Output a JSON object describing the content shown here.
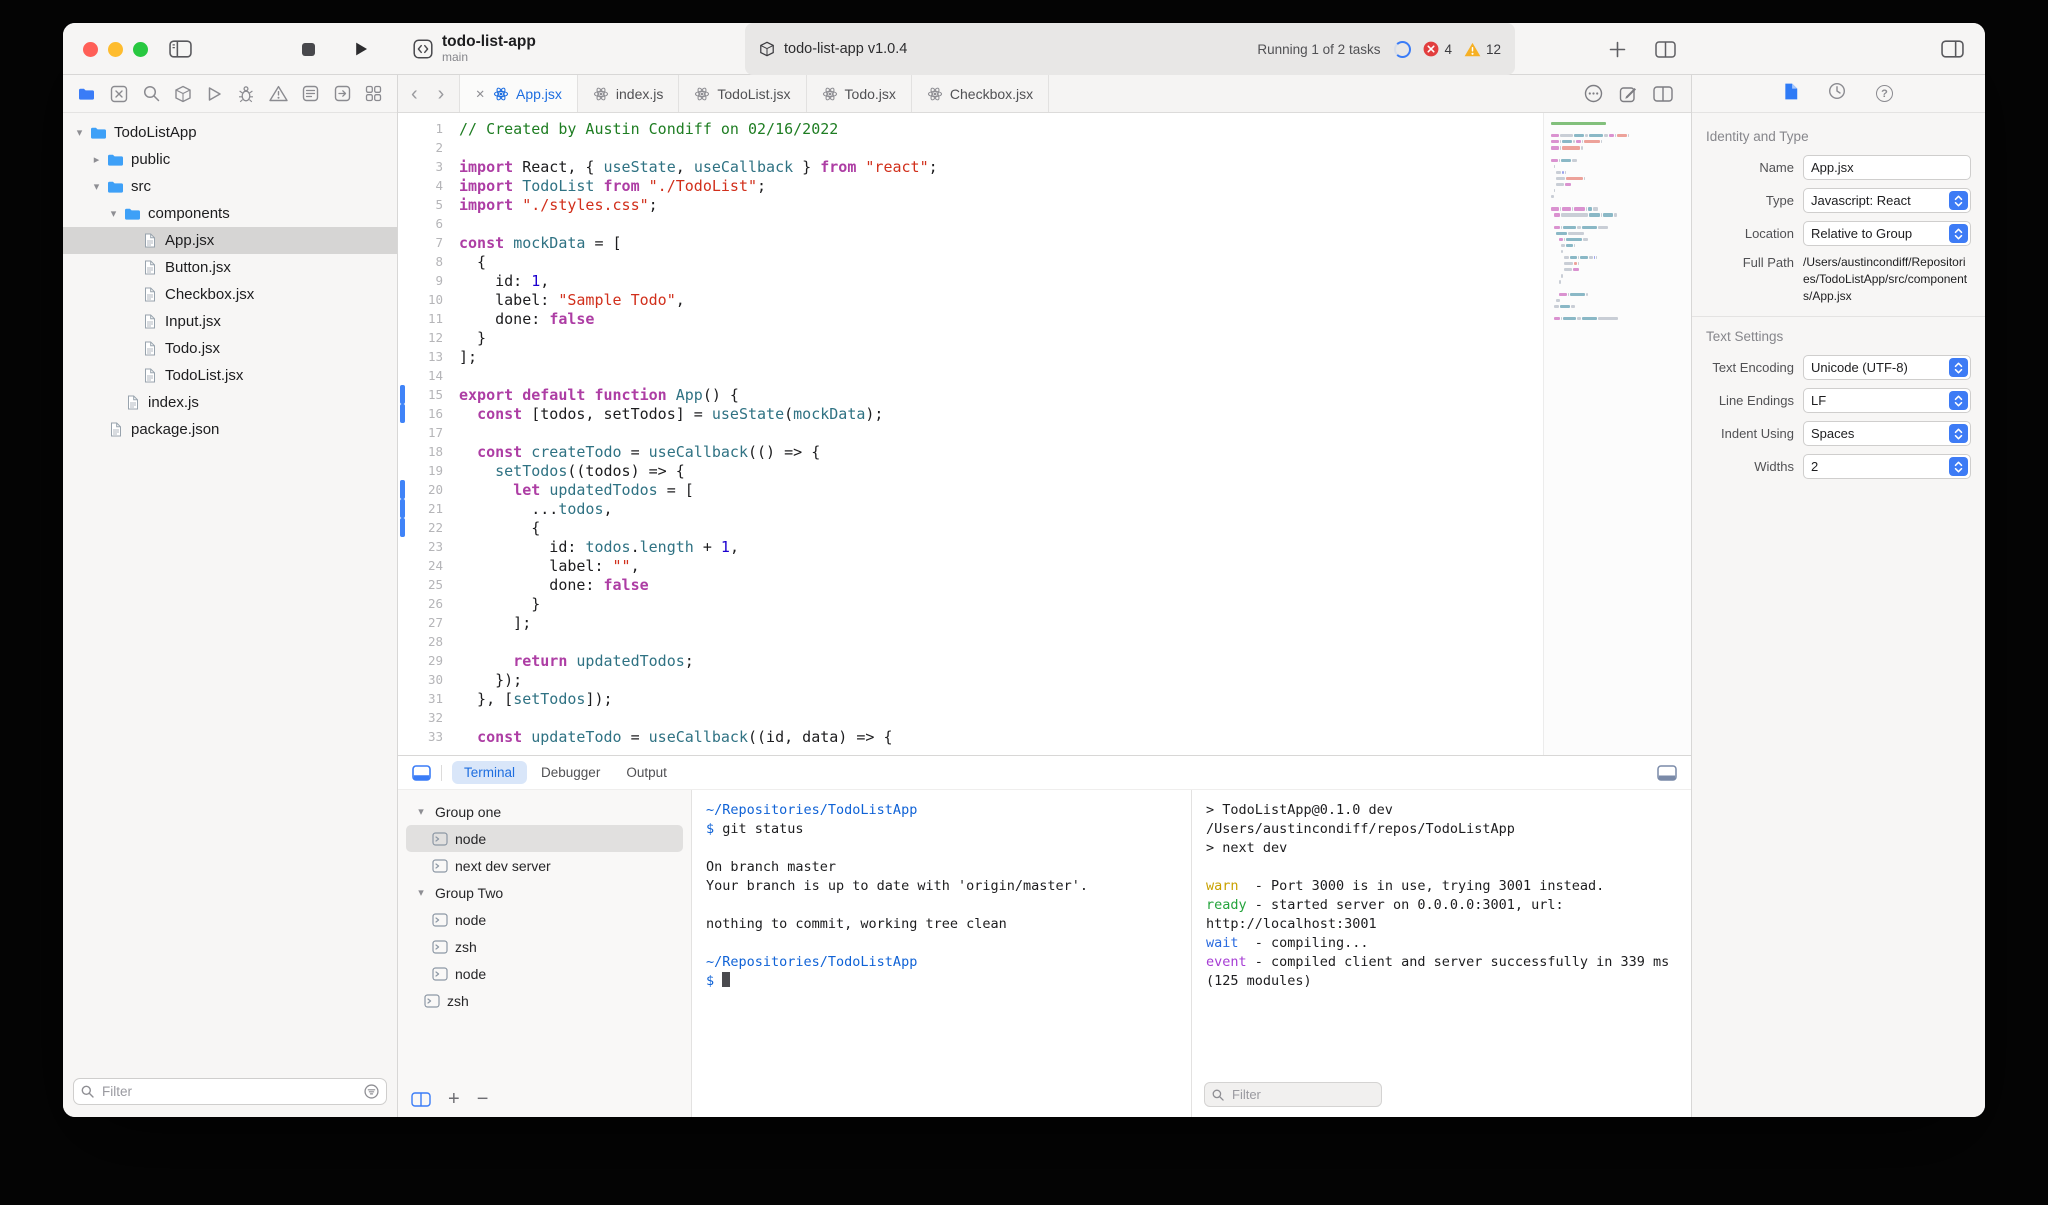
{
  "colors": {
    "accent": "#1e6ee0",
    "keyword": "#ad3da4",
    "string": "#d12f1b",
    "comment": "#1e7d22",
    "number": "#1c00cf",
    "identifier": "#2f7283",
    "error": "#e23e3e",
    "warning": "#f6b024"
  },
  "toolbar": {
    "project_name": "todo-list-app",
    "branch": "main",
    "scheme": {
      "title": "todo-list-app v1.0.4",
      "status": "Running 1 of 2 tasks",
      "errors": "4",
      "warnings": "12"
    }
  },
  "sidebar": {
    "filter_placeholder": "Filter",
    "nav_icons": [
      "project-navigator-icon",
      "source-editor-icon",
      "search-icon",
      "packages-icon",
      "run-icon",
      "bug-icon",
      "issues-icon",
      "reports-icon",
      "jump-icon",
      "extensions-icon"
    ],
    "tree": [
      {
        "label": "TodoListApp",
        "type": "folder",
        "depth": 0,
        "expanded": true
      },
      {
        "label": "public",
        "type": "folder",
        "depth": 1,
        "expanded": false
      },
      {
        "label": "src",
        "type": "folder",
        "depth": 1,
        "expanded": true
      },
      {
        "label": "components",
        "type": "folder",
        "depth": 2,
        "expanded": true
      },
      {
        "label": "App.jsx",
        "type": "file",
        "depth": 3,
        "selected": true
      },
      {
        "label": "Button.jsx",
        "type": "file",
        "depth": 3
      },
      {
        "label": "Checkbox.jsx",
        "type": "file",
        "depth": 3
      },
      {
        "label": "Input.jsx",
        "type": "file",
        "depth": 3
      },
      {
        "label": "Todo.jsx",
        "type": "file",
        "depth": 3
      },
      {
        "label": "TodoList.jsx",
        "type": "file",
        "depth": 3
      },
      {
        "label": "index.js",
        "type": "file",
        "depth": 2
      },
      {
        "label": "package.json",
        "type": "file",
        "depth": 1
      }
    ]
  },
  "editor": {
    "tabs": [
      {
        "label": "App.jsx",
        "active": true
      },
      {
        "label": "index.js"
      },
      {
        "label": "TodoList.jsx"
      },
      {
        "label": "Todo.jsx"
      },
      {
        "label": "Checkbox.jsx"
      }
    ],
    "changed_lines": [
      15,
      16,
      20,
      21,
      22
    ],
    "code": [
      [
        {
          "t": "// Created by Austin Condiff on 02/16/2022",
          "c": "c"
        }
      ],
      [],
      [
        {
          "t": "import",
          "c": "k"
        },
        {
          "t": " React, { ",
          "c": "p"
        },
        {
          "t": "useState",
          "c": "i"
        },
        {
          "t": ", ",
          "c": "p"
        },
        {
          "t": "useCallback",
          "c": "i"
        },
        {
          "t": " } ",
          "c": "p"
        },
        {
          "t": "from",
          "c": "k"
        },
        {
          "t": " ",
          "c": "p"
        },
        {
          "t": "\"react\"",
          "c": "s"
        },
        {
          "t": ";",
          "c": "p"
        }
      ],
      [
        {
          "t": "import",
          "c": "k"
        },
        {
          "t": " ",
          "c": "p"
        },
        {
          "t": "TodoList",
          "c": "i"
        },
        {
          "t": " ",
          "c": "p"
        },
        {
          "t": "from",
          "c": "k"
        },
        {
          "t": " ",
          "c": "p"
        },
        {
          "t": "\"./TodoList\"",
          "c": "s"
        },
        {
          "t": ";",
          "c": "p"
        }
      ],
      [
        {
          "t": "import",
          "c": "k"
        },
        {
          "t": " ",
          "c": "p"
        },
        {
          "t": "\"./styles.css\"",
          "c": "s"
        },
        {
          "t": ";",
          "c": "p"
        }
      ],
      [],
      [
        {
          "t": "const",
          "c": "k"
        },
        {
          "t": " ",
          "c": "p"
        },
        {
          "t": "mockData",
          "c": "i"
        },
        {
          "t": " = [",
          "c": "p"
        }
      ],
      [
        {
          "t": "  {",
          "c": "p"
        }
      ],
      [
        {
          "t": "    id: ",
          "c": "p"
        },
        {
          "t": "1",
          "c": "n"
        },
        {
          "t": ",",
          "c": "p"
        }
      ],
      [
        {
          "t": "    label: ",
          "c": "p"
        },
        {
          "t": "\"Sample Todo\"",
          "c": "s"
        },
        {
          "t": ",",
          "c": "p"
        }
      ],
      [
        {
          "t": "    done: ",
          "c": "p"
        },
        {
          "t": "false",
          "c": "k"
        }
      ],
      [
        {
          "t": "  }",
          "c": "p"
        }
      ],
      [
        {
          "t": "];",
          "c": "p"
        }
      ],
      [],
      [
        {
          "t": "export",
          "c": "k"
        },
        {
          "t": " ",
          "c": "p"
        },
        {
          "t": "default",
          "c": "k"
        },
        {
          "t": " ",
          "c": "p"
        },
        {
          "t": "function",
          "c": "k"
        },
        {
          "t": " ",
          "c": "p"
        },
        {
          "t": "App",
          "c": "i"
        },
        {
          "t": "() {",
          "c": "p"
        }
      ],
      [
        {
          "t": "  ",
          "c": "p"
        },
        {
          "t": "const",
          "c": "k"
        },
        {
          "t": " [todos, setTodos] = ",
          "c": "p"
        },
        {
          "t": "useState",
          "c": "i"
        },
        {
          "t": "(",
          "c": "p"
        },
        {
          "t": "mockData",
          "c": "i"
        },
        {
          "t": ");",
          "c": "p"
        }
      ],
      [],
      [
        {
          "t": "  ",
          "c": "p"
        },
        {
          "t": "const",
          "c": "k"
        },
        {
          "t": " ",
          "c": "p"
        },
        {
          "t": "createTodo",
          "c": "i"
        },
        {
          "t": " = ",
          "c": "p"
        },
        {
          "t": "useCallback",
          "c": "i"
        },
        {
          "t": "(() => {",
          "c": "p"
        }
      ],
      [
        {
          "t": "    ",
          "c": "p"
        },
        {
          "t": "setTodos",
          "c": "i"
        },
        {
          "t": "((todos) => {",
          "c": "p"
        }
      ],
      [
        {
          "t": "      ",
          "c": "p"
        },
        {
          "t": "let",
          "c": "k"
        },
        {
          "t": " ",
          "c": "p"
        },
        {
          "t": "updatedTodos",
          "c": "i"
        },
        {
          "t": " = [",
          "c": "p"
        }
      ],
      [
        {
          "t": "        ...",
          "c": "p"
        },
        {
          "t": "todos",
          "c": "i"
        },
        {
          "t": ",",
          "c": "p"
        }
      ],
      [
        {
          "t": "        {",
          "c": "p"
        }
      ],
      [
        {
          "t": "          id: ",
          "c": "p"
        },
        {
          "t": "todos",
          "c": "i"
        },
        {
          "t": ".",
          "c": "p"
        },
        {
          "t": "length",
          "c": "i"
        },
        {
          "t": " + ",
          "c": "p"
        },
        {
          "t": "1",
          "c": "n"
        },
        {
          "t": ",",
          "c": "p"
        }
      ],
      [
        {
          "t": "          label: ",
          "c": "p"
        },
        {
          "t": "\"\"",
          "c": "s"
        },
        {
          "t": ",",
          "c": "p"
        }
      ],
      [
        {
          "t": "          done: ",
          "c": "p"
        },
        {
          "t": "false",
          "c": "k"
        }
      ],
      [
        {
          "t": "        }",
          "c": "p"
        }
      ],
      [
        {
          "t": "      ];",
          "c": "p"
        }
      ],
      [],
      [
        {
          "t": "      ",
          "c": "p"
        },
        {
          "t": "return",
          "c": "k"
        },
        {
          "t": " ",
          "c": "p"
        },
        {
          "t": "updatedTodos",
          "c": "i"
        },
        {
          "t": ";",
          "c": "p"
        }
      ],
      [
        {
          "t": "    });",
          "c": "p"
        }
      ],
      [
        {
          "t": "  }, [",
          "c": "p"
        },
        {
          "t": "setTodos",
          "c": "i"
        },
        {
          "t": "]);",
          "c": "p"
        }
      ],
      [],
      [
        {
          "t": "  ",
          "c": "p"
        },
        {
          "t": "const",
          "c": "k"
        },
        {
          "t": " ",
          "c": "p"
        },
        {
          "t": "updateTodo",
          "c": "i"
        },
        {
          "t": " = ",
          "c": "p"
        },
        {
          "t": "useCallback",
          "c": "i"
        },
        {
          "t": "((id, data) => {",
          "c": "p"
        }
      ]
    ]
  },
  "inspector": {
    "header_icons": [
      "file-inspector-icon",
      "history-inspector-icon",
      "help-inspector-icon"
    ],
    "sections": [
      {
        "title": "Identity and Type",
        "fields": [
          {
            "label": "Name",
            "value": "App.jsx",
            "control": "text"
          },
          {
            "label": "Type",
            "value": "Javascript: React",
            "control": "popup"
          },
          {
            "label": "Location",
            "value": "Relative to Group",
            "control": "popup"
          },
          {
            "label": "Full Path",
            "value": "/Users/austincondiff/Repositories/TodoListApp/src/components/App.jsx",
            "control": "static"
          }
        ]
      },
      {
        "title": "Text Settings",
        "fields": [
          {
            "label": "Text Encoding",
            "value": "Unicode (UTF-8)",
            "control": "popup"
          },
          {
            "label": "Line Endings",
            "value": "LF",
            "control": "popup"
          },
          {
            "label": "Indent Using",
            "value": "Spaces",
            "control": "popup"
          },
          {
            "label": "Widths",
            "value": "2",
            "control": "stepper"
          }
        ]
      }
    ]
  },
  "panel": {
    "tabs": [
      {
        "label": "Terminal",
        "active": true
      },
      {
        "label": "Debugger"
      },
      {
        "label": "Output"
      }
    ],
    "filter_placeholder": "Filter",
    "sessions": [
      {
        "label": "Group one",
        "type": "group",
        "depth": 0,
        "expanded": true
      },
      {
        "label": "node",
        "type": "terminal",
        "depth": 1,
        "selected": true
      },
      {
        "label": "next dev server",
        "type": "terminal",
        "depth": 1
      },
      {
        "label": "Group Two",
        "type": "group",
        "depth": 0,
        "expanded": true
      },
      {
        "label": "node",
        "type": "terminal",
        "depth": 1
      },
      {
        "label": "zsh",
        "type": "terminal",
        "depth": 1
      },
      {
        "label": "node",
        "type": "terminal",
        "depth": 1
      },
      {
        "label": "zsh",
        "type": "terminal",
        "depth": 0
      }
    ],
    "terminal_left": [
      [
        {
          "t": "~/Repositories/TodoListApp",
          "c": "blue"
        }
      ],
      [
        {
          "t": "$ ",
          "c": "blue"
        },
        {
          "t": "git status",
          "c": "plain"
        }
      ],
      [],
      [
        {
          "t": "On branch master",
          "c": "plain"
        }
      ],
      [
        {
          "t": "Your branch is up to date with 'origin/master'.",
          "c": "plain"
        }
      ],
      [],
      [
        {
          "t": "nothing to commit, working tree clean",
          "c": "plain"
        }
      ],
      [],
      [
        {
          "t": "~/Repositories/TodoListApp",
          "c": "blue"
        }
      ],
      [
        {
          "t": "$ ",
          "c": "blue"
        },
        {
          "t": "",
          "c": "cursor"
        }
      ]
    ],
    "terminal_right": [
      [
        {
          "t": "> TodoListApp@0.1.0 dev /Users/austincondiff/repos/TodoListApp",
          "c": "plain"
        }
      ],
      [
        {
          "t": "> next dev",
          "c": "plain"
        }
      ],
      [],
      [
        {
          "t": "warn",
          "c": "yellow"
        },
        {
          "t": "  - Port 3000 is in use, trying 3001 instead.",
          "c": "plain"
        }
      ],
      [
        {
          "t": "ready",
          "c": "green"
        },
        {
          "t": " - started server on 0.0.0.0:3001, url: http://localhost:3001",
          "c": "plain"
        }
      ],
      [
        {
          "t": "wait",
          "c": "blue2"
        },
        {
          "t": "  - compiling...",
          "c": "plain"
        }
      ],
      [
        {
          "t": "event",
          "c": "magenta"
        },
        {
          "t": " - compiled client and server successfully in 339 ms (125 modules)",
          "c": "plain"
        }
      ]
    ]
  }
}
